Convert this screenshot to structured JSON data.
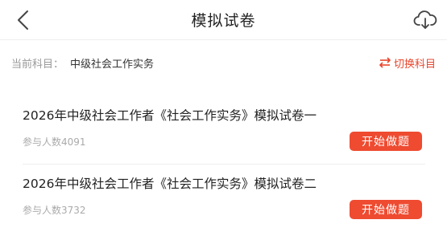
{
  "header": {
    "title": "模拟试卷"
  },
  "subject": {
    "label": "当前科目：",
    "value": "中级社会工作实务",
    "switch_label": "切换科目"
  },
  "papers": [
    {
      "title": "2026年中级社会工作者《社会工作实务》模拟试卷一",
      "participants": "参与人数4091",
      "button": "开始做题"
    },
    {
      "title": "2026年中级社会工作者《社会工作实务》模拟试卷二",
      "participants": "参与人数3732",
      "button": "开始做题"
    }
  ],
  "colors": {
    "accent": "#ee4b31",
    "switch": "#e8452c"
  },
  "icons": {
    "back": "chevron-left-icon",
    "download": "cloud-download-icon",
    "switch": "swap-arrows-icon"
  }
}
